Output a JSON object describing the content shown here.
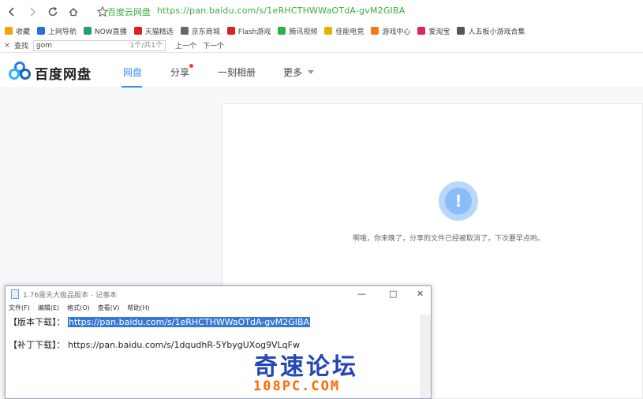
{
  "browser": {
    "site_name": "百度云网盘",
    "address_url": "https://pan.baidu.com/s/1eRHCTHWWaOTdA-gvM2GIBA",
    "bookmarks": [
      {
        "label": "收藏",
        "color": "#f0a30a"
      },
      {
        "label": "上网导航",
        "color": "#2a6fd6"
      },
      {
        "label": "NOW直播",
        "color": "#22a06b"
      },
      {
        "label": "天猫精选",
        "color": "#d9231f"
      },
      {
        "label": "京东商城",
        "color": "#666666"
      },
      {
        "label": "Flash游戏",
        "color": "#d9231f"
      },
      {
        "label": "腾讯视频",
        "color": "#2ab24f"
      },
      {
        "label": "佳能电竞",
        "color": "#e2b400"
      },
      {
        "label": "游戏中心",
        "color": "#f07a1a"
      },
      {
        "label": "爱淘宝",
        "color": "#e0245e"
      },
      {
        "label": "人五板小游戏合集",
        "color": "#555555"
      }
    ]
  },
  "findbar": {
    "close_icon": "×",
    "label": "查找",
    "query": "gom",
    "count": "1个/共1个",
    "prev_label": "上一个",
    "next_label": "下一个"
  },
  "baidu": {
    "brand": "百度网盘",
    "nav": {
      "disk": "网盘",
      "share": "分享",
      "photos": "一刻相册",
      "more": "更多"
    },
    "accent": "#3b8cff"
  },
  "content": {
    "warn_symbol": "!",
    "message": "啊哦，你来晚了，分享的文件已经被取消了，下次要早点哟。"
  },
  "notepad": {
    "title": "1.76雷天大极品版本 - 记事本",
    "controls": {
      "minimize": "—",
      "maximize": "□",
      "close": "✕"
    },
    "menu": [
      "文件(F)",
      "编辑(E)",
      "格式(O)",
      "查看(V)",
      "帮助(H)"
    ],
    "line1_label": "【版本下载】：",
    "line1_url": "https://pan.baidu.com/s/1eRHCTHWWaOTdA-gvM2GIBA",
    "line2_label": "【补丁下载】：",
    "line2_url": "https://pan.baidu.com/s/1dqudhR-5YbygUXog9VLqFw"
  },
  "watermark": {
    "main": "奇速论坛",
    "sub": "108PC.COM"
  }
}
